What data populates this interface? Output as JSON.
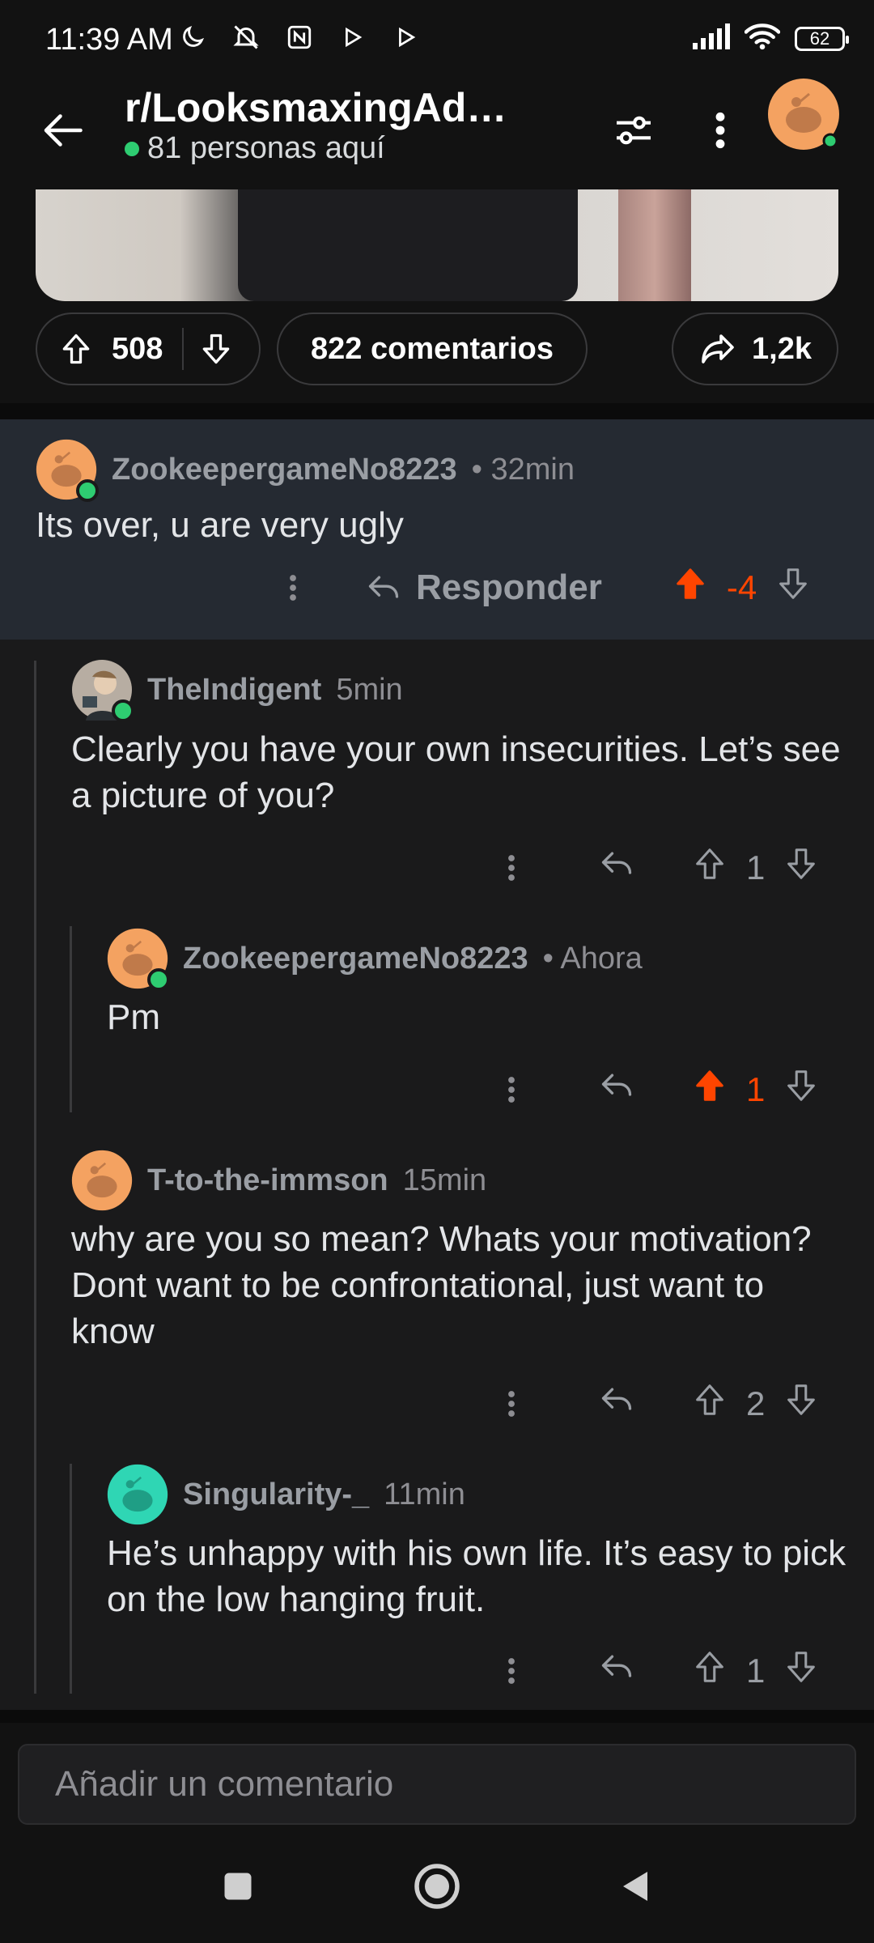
{
  "status_bar": {
    "time": "11:39 AM",
    "battery": "62"
  },
  "header": {
    "title": "r/LooksmaxingAd…",
    "online_text": "81 personas aquí"
  },
  "post_actions": {
    "votes": "508",
    "comments": "822 comentarios",
    "shares": "1,2k"
  },
  "comments": [
    {
      "author": "ZookeepergameNo8223",
      "meta": "• 32min",
      "body": "Its over, u are very ugly",
      "reply_label": "Responder",
      "score": "-4",
      "upvoted": true,
      "avatar_color": "#f4a261"
    },
    {
      "author": "TheIndigent",
      "meta": "5min",
      "body": "Clearly you have your own insecurities. Let’s see a picture of you?",
      "score": "1"
    },
    {
      "author": "ZookeepergameNo8223",
      "meta": "• Ahora",
      "body": "Pm",
      "score": "1",
      "upvoted": true,
      "avatar_color": "#f4a261"
    },
    {
      "author": "T-to-the-immson",
      "meta": "15min",
      "body": "why are you so mean? Whats your motivation? Dont want to be confrontational, just want to know",
      "score": "2",
      "avatar_color": "#f4a261"
    },
    {
      "author": "Singularity-_",
      "meta": "11min",
      "body": "He’s unhappy with his own life. It’s easy to pick on the low hanging fruit.",
      "score": "1",
      "avatar_color": "#2fd6b4"
    }
  ],
  "input": {
    "placeholder": "Añadir un comentario"
  },
  "colors": {
    "upvote": "#ff4500",
    "online": "#2ecc71",
    "background": "#1a1a1b",
    "highlight": "#252a32"
  },
  "icons": [
    "back-arrow-icon",
    "filter-icon",
    "more-vertical-icon",
    "upvote-icon",
    "downvote-icon",
    "share-icon",
    "reply-icon"
  ]
}
